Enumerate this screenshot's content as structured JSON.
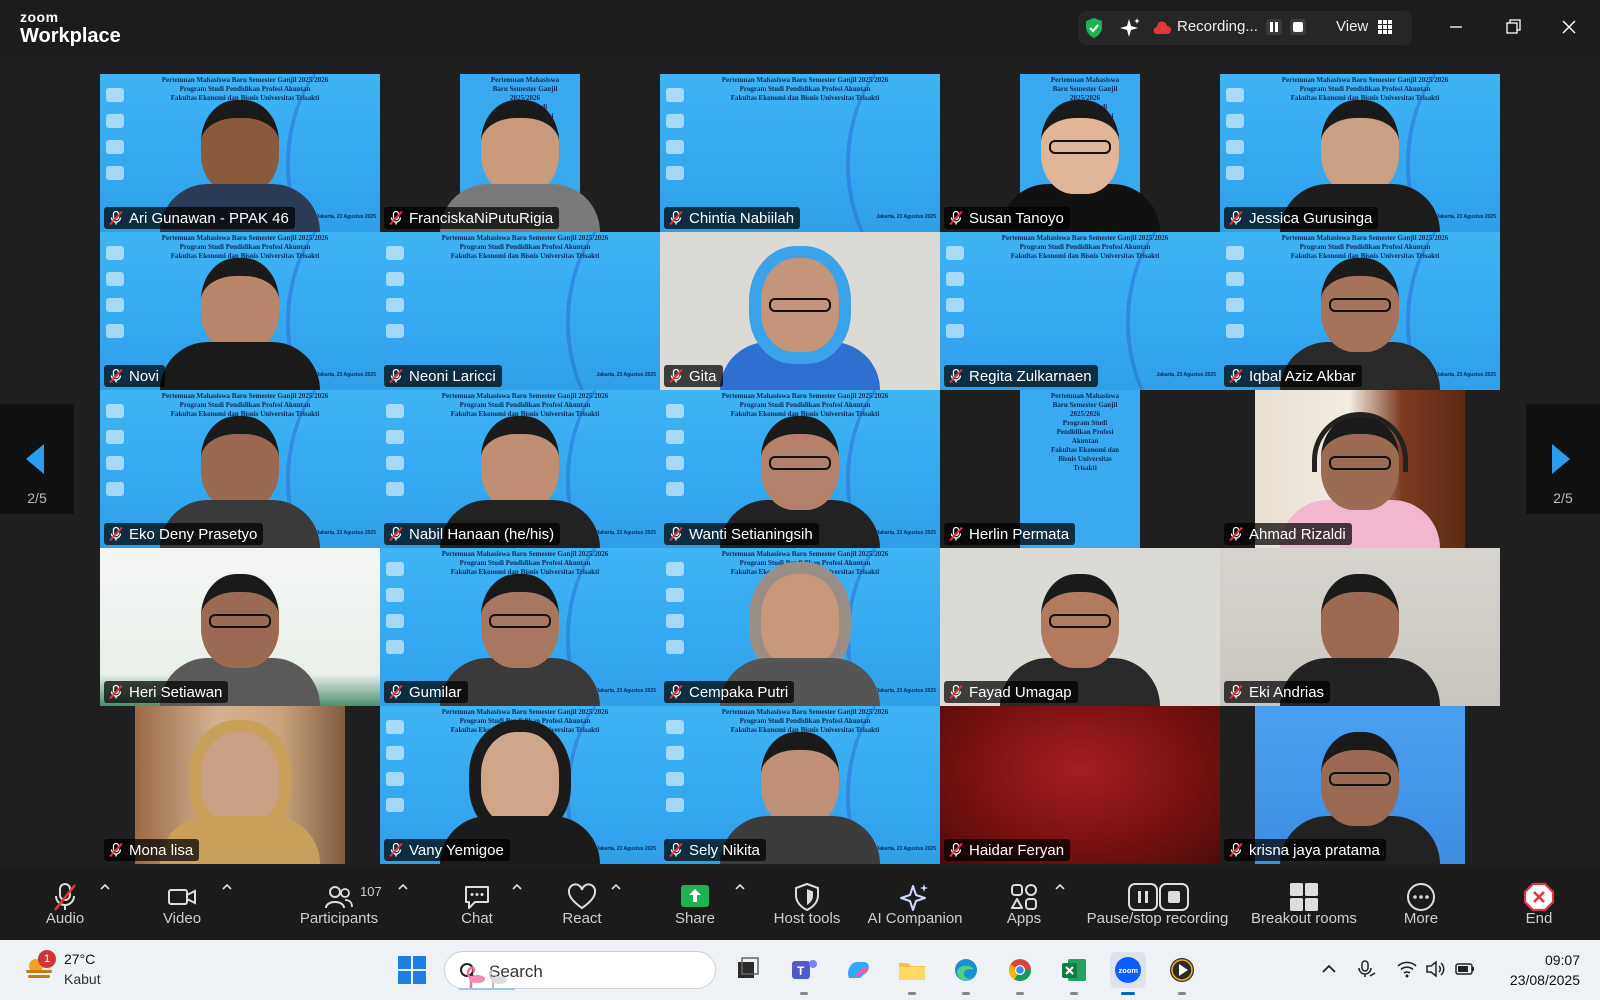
{
  "app": {
    "brand_small": "zoom",
    "brand_large": "Workplace",
    "recording_label": "Recording...",
    "view_label": "View"
  },
  "pagination": {
    "left": "2/5",
    "right": "2/5"
  },
  "participants": [
    {
      "name": "Ari Gunawan - PPAK 46"
    },
    {
      "name": "FranciskaNiPutuRigia"
    },
    {
      "name": "Chintia Nabiilah"
    },
    {
      "name": "Susan Tanoyo"
    },
    {
      "name": "Jessica Gurusinga"
    },
    {
      "name": "Novi"
    },
    {
      "name": "Neoni Laricci"
    },
    {
      "name": "Gita"
    },
    {
      "name": "Regita Zulkarnaen"
    },
    {
      "name": "Iqbal Aziz Akbar"
    },
    {
      "name": "Eko Deny Prasetyo"
    },
    {
      "name": "Nabil Hanaan (he/his)"
    },
    {
      "name": "Wanti Setianingsih"
    },
    {
      "name": "Herlin Permata"
    },
    {
      "name": "Ahmad Rizaldi"
    },
    {
      "name": "Heri Setiawan"
    },
    {
      "name": "Gumilar"
    },
    {
      "name": "Cempaka Putri"
    },
    {
      "name": "Fayad Umagap"
    },
    {
      "name": "Eki Andrias"
    },
    {
      "name": "Mona lisa"
    },
    {
      "name": "Vany Yemigoe"
    },
    {
      "name": "Sely Nikita"
    },
    {
      "name": "Haidar Feryan"
    },
    {
      "name": "krisna jaya pratama"
    }
  ],
  "slide": {
    "line1": "Pertemuan Mahasiswa Baru Semester Ganjil 2025/2026",
    "line2": "Program Studi Pendidikan Profesi Akuntan",
    "line3": "Fakultas Ekonomi dan Bisnis Universitas Trisakti",
    "date": "Jakarta, 23 Agustus 2025"
  },
  "toolbar": {
    "audio": "Audio",
    "video": "Video",
    "participants": "Participants",
    "participants_count": "107",
    "chat": "Chat",
    "react": "React",
    "share": "Share",
    "host_tools": "Host tools",
    "ai_companion": "AI Companion",
    "apps": "Apps",
    "pause_recording": "Pause/stop recording",
    "breakout_rooms": "Breakout rooms",
    "more": "More",
    "end": "End"
  },
  "taskbar": {
    "weather_badge": "1",
    "temperature": "27°C",
    "condition": "Kabut",
    "search_placeholder": "Search",
    "time": "09:07",
    "date": "23/08/2025"
  },
  "colors": {
    "accent_green": "#1fb254",
    "end_red": "#e0363f",
    "slide_blue": "#3aabf2",
    "mic_muted": "#e0363f"
  }
}
